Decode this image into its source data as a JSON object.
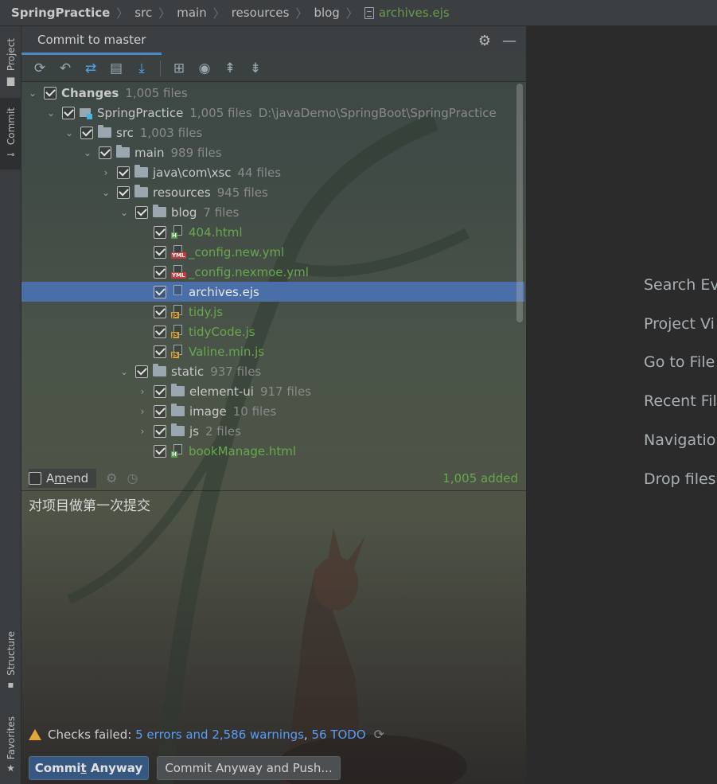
{
  "breadcrumb": {
    "project": "SpringPractice",
    "items": [
      "src",
      "main",
      "resources",
      "blog"
    ],
    "file": "archives.ejs"
  },
  "left_strip": {
    "project_label": "Project",
    "commit_label": "Commit",
    "structure_label": "Structure",
    "favorites_label": "Favorites"
  },
  "panel": {
    "tab_title": "Commit to master"
  },
  "tree": {
    "changes_label": "Changes",
    "changes_count": "1,005 files",
    "project_name": "SpringPractice",
    "project_count": "1,005 files",
    "project_path": "D:\\javaDemo\\SpringBoot\\SpringPractice",
    "src_name": "src",
    "src_count": "1,003 files",
    "main_name": "main",
    "main_count": "989 files",
    "java_name": "java\\com\\xsc",
    "java_count": "44 files",
    "resources_name": "resources",
    "resources_count": "945 files",
    "blog_name": "blog",
    "blog_count": "7 files",
    "files": [
      {
        "name": "404.html",
        "type": "html"
      },
      {
        "name": "_config.new.yml",
        "type": "yml"
      },
      {
        "name": "_config.nexmoe.yml",
        "type": "yml"
      },
      {
        "name": "archives.ejs",
        "type": "ejs"
      },
      {
        "name": "tidy.js",
        "type": "js"
      },
      {
        "name": "tidyCode.js",
        "type": "js"
      },
      {
        "name": "Valine.min.js",
        "type": "js"
      }
    ],
    "static_name": "static",
    "static_count": "937 files",
    "element_name": "element-ui",
    "element_count": "917 files",
    "image_name": "image",
    "image_count": "10 files",
    "js_name": "js",
    "js_count": "2 files",
    "bookmanage_name": "bookManage.html"
  },
  "amend": {
    "label_pre": "A",
    "label_underline": "m",
    "label_post": "end",
    "added": "1,005 added"
  },
  "commit_message": "对项目做第一次提交",
  "checks": {
    "prefix": "Checks failed:",
    "errors": "5 errors and 2,586 warnings",
    "sep": ",",
    "todo": "56 TODO"
  },
  "buttons": {
    "commit_pre": "Commi",
    "commit_underline": "t",
    "commit_post": " Anyway",
    "commit_push": "Commit Anyway and Push..."
  },
  "right_hints": [
    "Search Ev",
    "Project Vi",
    "Go to File",
    "Recent Fil",
    "Navigatio",
    "Drop files"
  ],
  "colors": {
    "accent": "#4a88c7",
    "selection": "#4a6fa8",
    "added_green": "#67a84c",
    "link_blue": "#589df6",
    "warning": "#e4a83a"
  }
}
